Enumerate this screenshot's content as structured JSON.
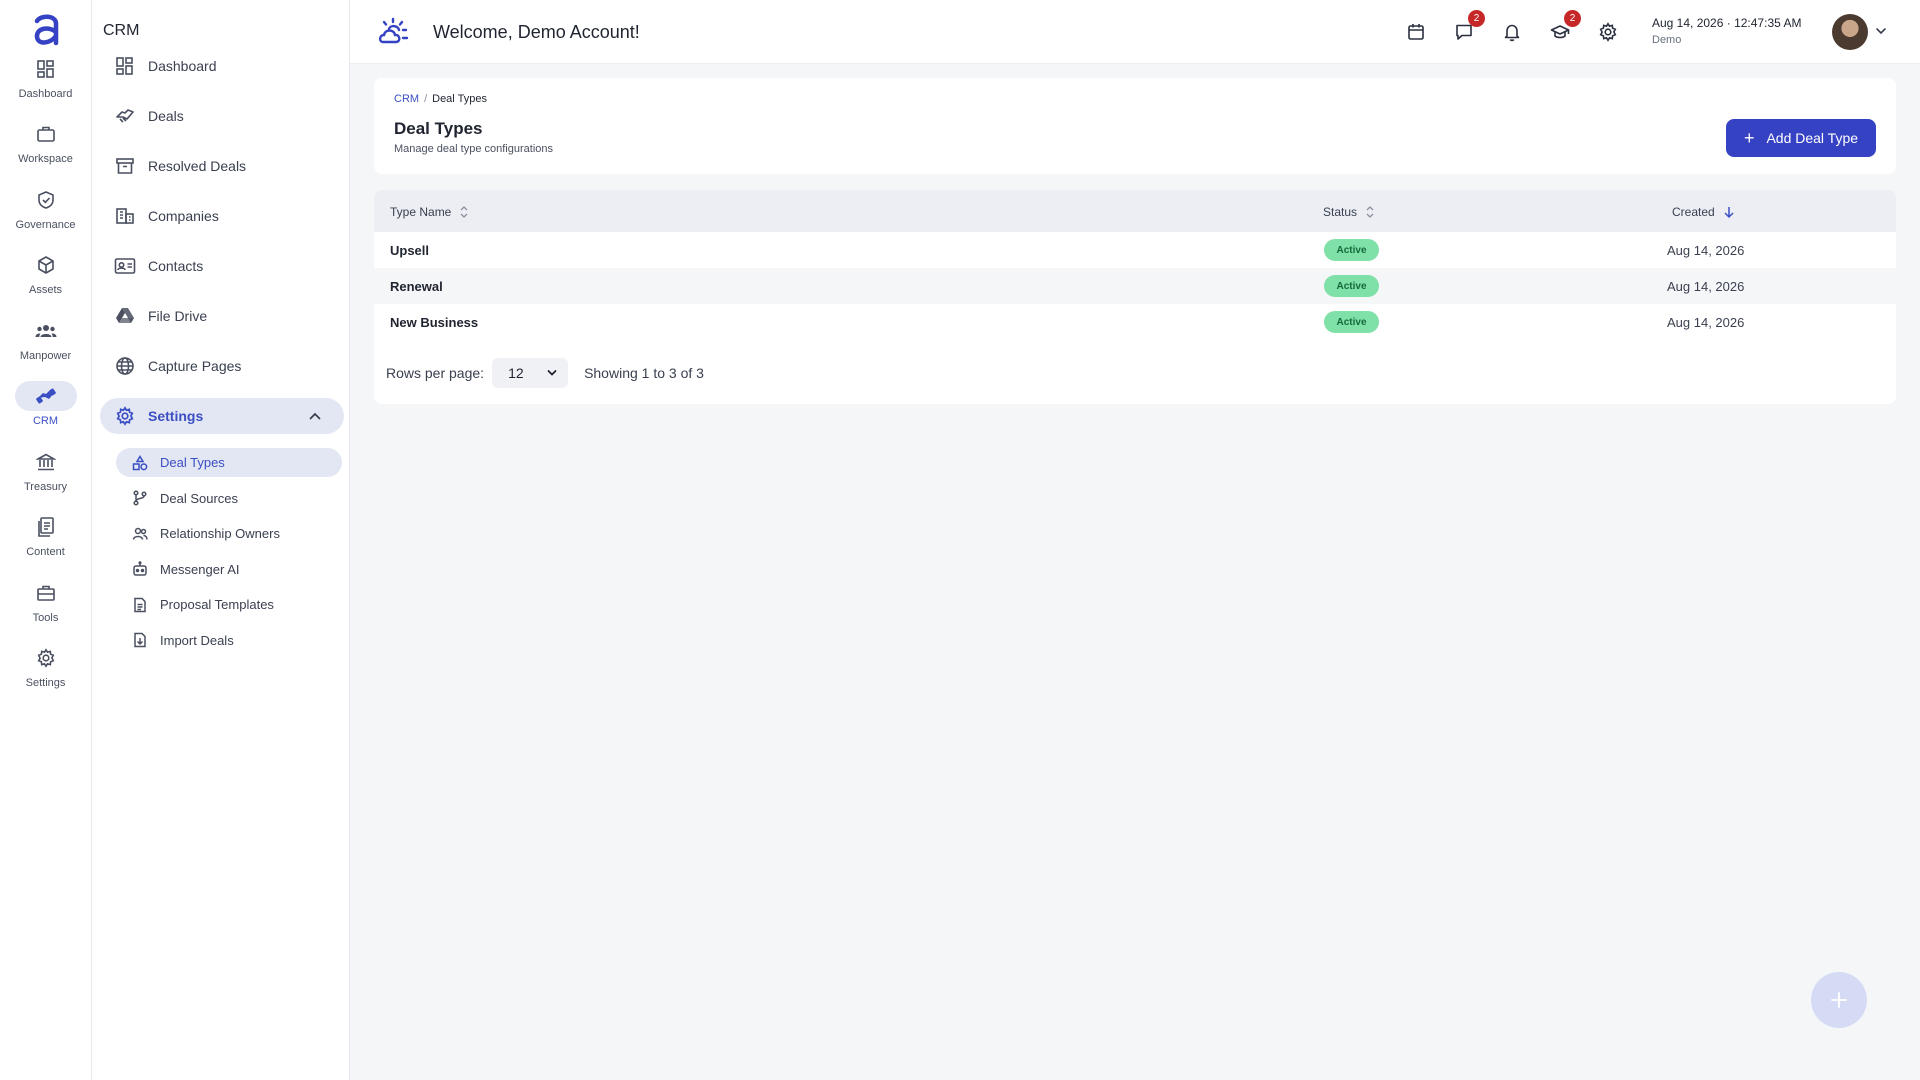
{
  "rail": {
    "items": [
      {
        "label": "Dashboard",
        "icon": "dashboard-icon"
      },
      {
        "label": "Workspace",
        "icon": "briefcase-icon"
      },
      {
        "label": "Governance",
        "icon": "shield-check-icon"
      },
      {
        "label": "Assets",
        "icon": "cube-icon"
      },
      {
        "label": "Manpower",
        "icon": "people-icon"
      },
      {
        "label": "CRM",
        "icon": "handshake-icon"
      },
      {
        "label": "Treasury",
        "icon": "bank-icon"
      },
      {
        "label": "Content",
        "icon": "document-icon"
      },
      {
        "label": "Tools",
        "icon": "toolbox-icon"
      },
      {
        "label": "Settings",
        "icon": "gear-icon"
      }
    ],
    "active": "CRM"
  },
  "sidebar": {
    "title": "CRM",
    "items": [
      {
        "label": "Dashboard"
      },
      {
        "label": "Deals"
      },
      {
        "label": "Resolved Deals"
      },
      {
        "label": "Companies"
      },
      {
        "label": "Contacts"
      },
      {
        "label": "File Drive"
      },
      {
        "label": "Capture Pages"
      },
      {
        "label": "Settings"
      }
    ],
    "settings_children": [
      {
        "label": "Deal Types"
      },
      {
        "label": "Deal Sources"
      },
      {
        "label": "Relationship Owners"
      },
      {
        "label": "Messenger AI"
      },
      {
        "label": "Proposal Templates"
      },
      {
        "label": "Import Deals"
      }
    ]
  },
  "topbar": {
    "welcome": "Welcome, Demo Account!",
    "messages_badge": "2",
    "courses_badge": "2",
    "date": "Aug 14, 2026",
    "time": "12:47:35 AM",
    "user": "Demo"
  },
  "page": {
    "breadcrumb_parent": "CRM",
    "breadcrumb_sep": "/",
    "breadcrumb_current": "Deal Types",
    "title": "Deal Types",
    "subtitle": "Manage deal type configurations",
    "add_button": "Add Deal Type"
  },
  "table": {
    "columns": [
      "Type Name",
      "Status",
      "Created"
    ],
    "rows": [
      {
        "name": "Upsell",
        "status": "Active",
        "created": "Aug 14, 2026"
      },
      {
        "name": "Renewal",
        "status": "Active",
        "created": "Aug 14, 2026"
      },
      {
        "name": "New Business",
        "status": "Active",
        "created": "Aug 14, 2026"
      }
    ],
    "rows_per_page_label": "Rows per page:",
    "rows_per_page": "12",
    "showing": "Showing 1 to 3 of 3"
  },
  "colors": {
    "accent": "#3b4fc4",
    "button": "#3642c4",
    "active_badge": "#7fe0a8",
    "notification_badge": "#c62828"
  }
}
